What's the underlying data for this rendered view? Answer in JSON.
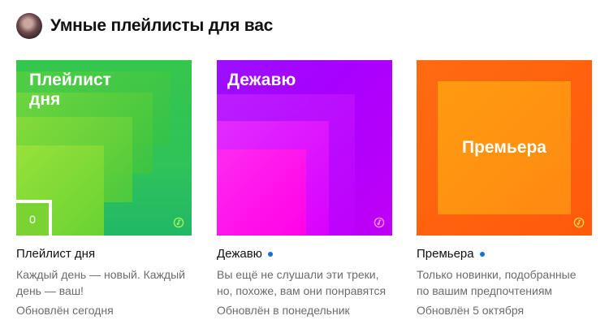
{
  "section": {
    "title": "Умные плейлисты для вас"
  },
  "cards": [
    {
      "cover_label_line1": "Плейлист",
      "cover_label_line2": "дня",
      "badge_value": "0",
      "title": "Плейлист дня",
      "desc_line1": "Каждый день — новый. Каждый",
      "desc_line2": "день — ваш!",
      "updated": "Обновлён сегодня",
      "new_dot": false,
      "accent": "#2fc35a"
    },
    {
      "cover_label_line1": "Дежавю",
      "title": "Дежавю",
      "desc_line1": "Вы ещё не слушали эти треки,",
      "desc_line2": "но, похоже, вам они понравятся",
      "updated": "Обновлён в понедельник",
      "new_dot": true,
      "accent": "#a800ff"
    },
    {
      "cover_label_line1": "Премьера",
      "title": "Премьера",
      "desc_line1": "Только новинки, подобранные",
      "desc_line2": "по вашим предпочтениям",
      "updated": "Обновлён 5 октября",
      "new_dot": true,
      "accent": "#ff6b12"
    }
  ],
  "icons": {
    "cover_logo": "music-note-circle-icon",
    "new_dot": "dot-icon"
  },
  "colors": {
    "new_dot": "#1570d1",
    "secondary_text": "#6b6b6b"
  }
}
